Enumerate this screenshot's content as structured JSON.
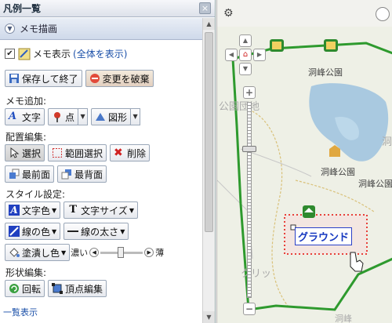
{
  "panel": {
    "title": "凡例一覧",
    "close_glyph": "×",
    "section_title": "メモ描画",
    "memo_display_label": "メモ表示",
    "show_all_link": "(全体を表示)",
    "save_exit_label": "保存して終了",
    "discard_label": "変更を破棄",
    "memo_add_label": "メモ追加:",
    "text_label": "文字",
    "point_label": "点",
    "shape_label": "図形",
    "layout_edit_label": "配置編集:",
    "select_label": "選択",
    "range_select_label": "範囲選択",
    "delete_label": "削除",
    "front_label": "最前面",
    "back_label": "最背面",
    "style_label": "スタイル設定:",
    "text_color_label": "文字色",
    "text_size_label": "文字サイズ",
    "line_color_label": "線の色",
    "line_width_label": "線の太さ",
    "fill_color_label": "塗潰し色",
    "opacity_dark": "濃い",
    "opacity_light": "薄",
    "shape_edit_label": "形状編集:",
    "rotate_label": "回転",
    "vertex_edit_label": "頂点編集",
    "list_link": "一覧表示"
  },
  "map": {
    "labels": {
      "park_top": "洞峰公園",
      "area_name": "洞峰公園",
      "park_mid": "洞峰公園",
      "faint_block": "公園団地",
      "bottom_faint": "クリッ",
      "right_faint": "洞",
      "right_faint2": "洞峰"
    },
    "selected_memo_text": "グラウンド",
    "colors": {
      "park_boundary": "#2e9a2e",
      "pond": "#a9c9e0",
      "selection": "#e8403a",
      "memo_text": "#1638c0"
    }
  }
}
